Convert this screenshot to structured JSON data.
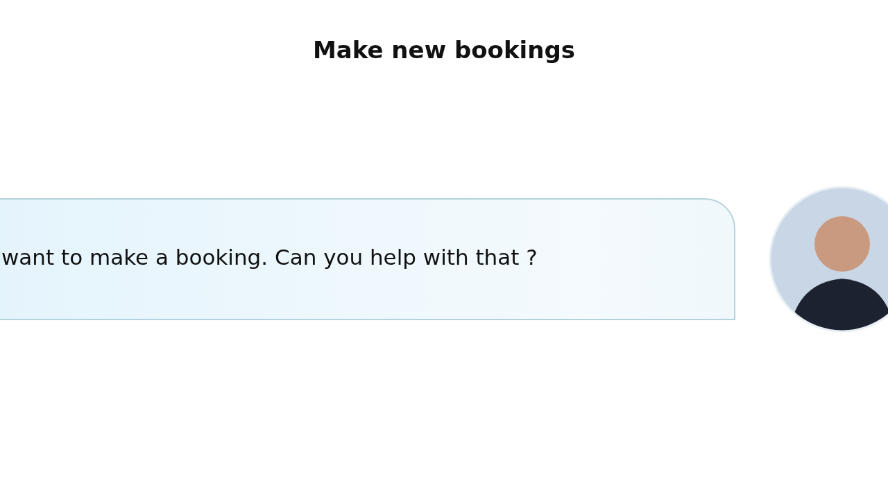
{
  "title": "Make new bookings",
  "message": {
    "text": "want to make a booking. Can you help with that ?"
  }
}
